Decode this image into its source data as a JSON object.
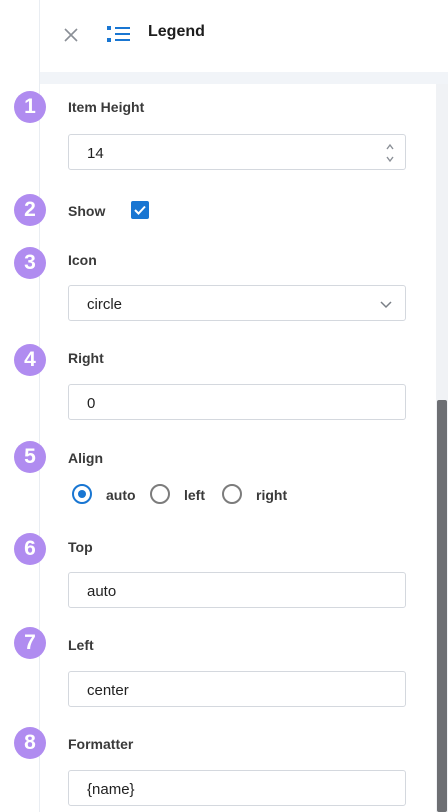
{
  "header": {
    "title": "Legend"
  },
  "colors": {
    "accent": "#1976d2",
    "badge": "#b08cf0"
  },
  "fields": [
    {
      "badge": "1",
      "label": "Item Height",
      "value": "14"
    },
    {
      "badge": "2",
      "label": "Show",
      "checked": true
    },
    {
      "badge": "3",
      "label": "Icon",
      "value": "circle"
    },
    {
      "badge": "4",
      "label": "Right",
      "value": "0"
    },
    {
      "badge": "5",
      "label": "Align",
      "options": [
        "auto",
        "left",
        "right"
      ],
      "selected": "auto"
    },
    {
      "badge": "6",
      "label": "Top",
      "value": "auto"
    },
    {
      "badge": "7",
      "label": "Left",
      "value": "center"
    },
    {
      "badge": "8",
      "label": "Formatter",
      "value": "{name}"
    }
  ]
}
